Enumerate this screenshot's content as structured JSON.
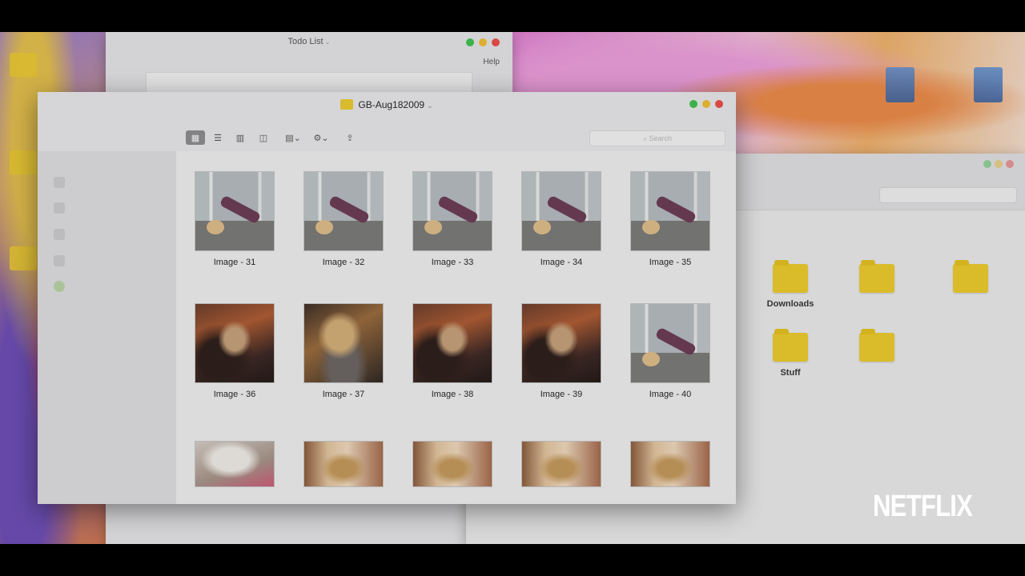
{
  "todo_window": {
    "title": "Todo List",
    "menu_help": "Help"
  },
  "finder": {
    "title": "GB-Aug182009",
    "search_placeholder": "Search",
    "images": [
      {
        "label": "Image - 31",
        "kind": "studio"
      },
      {
        "label": "Image - 32",
        "kind": "studio"
      },
      {
        "label": "Image - 33",
        "kind": "studio"
      },
      {
        "label": "Image - 34",
        "kind": "studio"
      },
      {
        "label": "Image - 35",
        "kind": "studio"
      },
      {
        "label": "Image - 36",
        "kind": "party"
      },
      {
        "label": "Image - 37",
        "kind": "party2"
      },
      {
        "label": "Image - 38",
        "kind": "party"
      },
      {
        "label": "Image - 39",
        "kind": "party"
      },
      {
        "label": "Image - 40",
        "kind": "studio"
      },
      {
        "label": "",
        "kind": "white"
      },
      {
        "label": "",
        "kind": "window"
      },
      {
        "label": "",
        "kind": "window"
      },
      {
        "label": "",
        "kind": "window"
      },
      {
        "label": "",
        "kind": "window"
      }
    ]
  },
  "right_window": {
    "folders": [
      {
        "label": "Downloads",
        "faint": false
      },
      {
        "label": "",
        "faint": true
      },
      {
        "label": "",
        "faint": true
      },
      {
        "label": "Stuff",
        "faint": false
      },
      {
        "label": "",
        "faint": true
      }
    ]
  },
  "watermark": "NETFLIX",
  "colors": {
    "folder": "#f0cd2c",
    "close": "#ef4b47",
    "minimize": "#f4bf2f",
    "zoom": "#3dc34c"
  }
}
